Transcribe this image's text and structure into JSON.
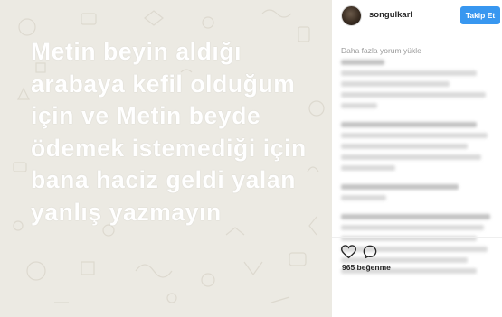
{
  "post": {
    "text": "Metin beyin aldığı\narabaya kefil olduğum\niçin ve Metin beyde\nödemek istemediği için\nbana haciz geldi yalan\nyanlış yazmayın"
  },
  "header": {
    "username": "songulkarl",
    "follow_label": "Takip Et",
    "avatar_icon": "profile-avatar"
  },
  "comments": {
    "load_more_label": "Daha fazla yorum yükle"
  },
  "actions": {
    "like_icon": "heart-icon",
    "comment_icon": "speech-bubble-icon",
    "likes_text": "965 beğenme"
  },
  "colors": {
    "accent": "#3897f0",
    "post_background": "#eceae3",
    "text_muted": "#999999"
  }
}
